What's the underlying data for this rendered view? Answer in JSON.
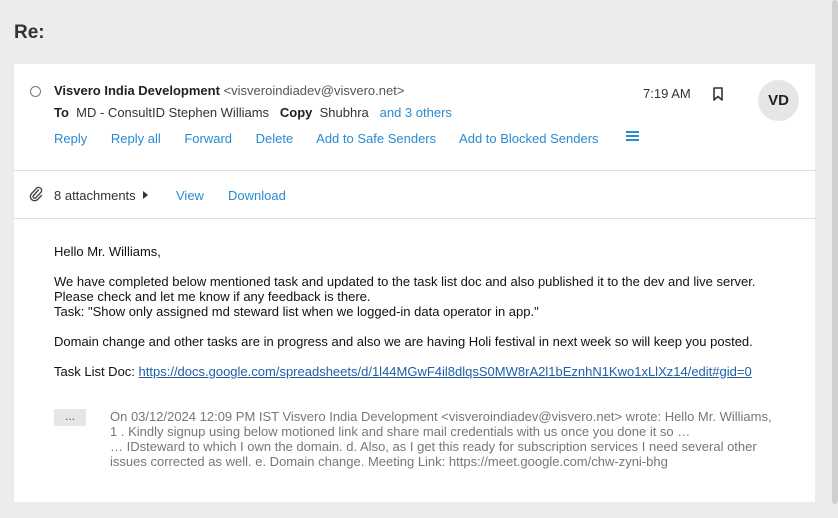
{
  "subject": "Re:",
  "header": {
    "sender_name": "Visvero India Development",
    "sender_email": "<visveroindiadev@visvero.net>",
    "to_label": "To",
    "to_value": "MD - ConsultID Stephen Williams",
    "copy_label": "Copy",
    "copy_value": "Shubhra",
    "others_link": "and 3 others",
    "time": "7:19 AM",
    "avatar_initials": "VD"
  },
  "actions": {
    "reply": "Reply",
    "reply_all": "Reply all",
    "forward": "Forward",
    "delete": "Delete",
    "add_safe": "Add to Safe Senders",
    "add_blocked": "Add to Blocked Senders"
  },
  "attachments": {
    "count_text": "8 attachments",
    "view": "View",
    "download": "Download"
  },
  "body": {
    "greeting": "Hello Mr. Williams,",
    "p1_line1": "We have completed below mentioned task and updated to the task list doc and also published it to the dev and live server.",
    "p1_line2": "Please check and let me know if any feedback is there.",
    "p1_line3": "Task: \"Show only assigned md steward list when we logged-in data operator in app.\"",
    "p2": "Domain change and other tasks are in progress and also we are having Holi festival in next week so will keep you posted.",
    "doc_label": "Task List Doc: ",
    "doc_link": " https://docs.google.com/spreadsheets/d/1l44MGwF4il8dlqsS0MW8rA2l1bEznhN1Kwo1xLlXz14/edit#gid=0"
  },
  "quoted": {
    "button": "...",
    "line1": "On 03/12/2024 12:09 PM IST Visvero India Development <visveroindiadev@visvero.net> wrote: Hello Mr. Williams,",
    "line2": "1 . Kindly signup using below motioned link and share mail credentials with us once you done it so …",
    "line3": "… IDsteward to which I own the domain. d. Also, as I get this ready for subscription services I need several other",
    "line4": "issues corrected as well. e. Domain change. Meeting Link: https://meet.google.com/chw-zyni-bhg"
  },
  "icons": {
    "bookmark": "bookmark-icon",
    "menu": "hamburger-menu-icon",
    "attachment": "paperclip-icon",
    "expand": "caret-right-icon",
    "select": "radio-circle-icon"
  },
  "colors": {
    "link": "#2a8bd0",
    "background": "#ececec",
    "card": "#ffffff"
  }
}
